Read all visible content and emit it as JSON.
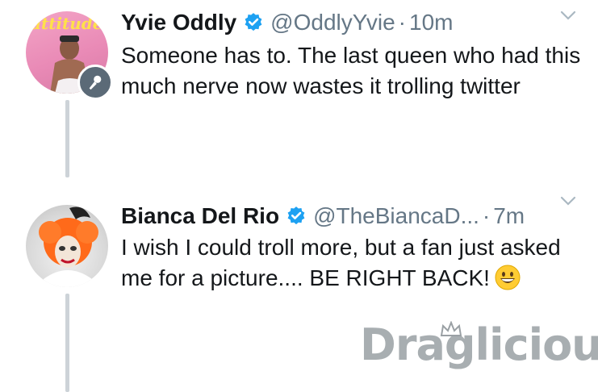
{
  "tweets": [
    {
      "name": "Yvie Oddly",
      "handle": "@OddlyYvie",
      "separator": "·",
      "time": "10m",
      "text": "Someone has to. The last queen who had this much nerve now wastes it trolling twitter",
      "avatar_icon": "profile-photo",
      "badge_icon": "microphone-icon"
    },
    {
      "name": "Bianca Del Rio",
      "handle": "@TheBiancaD...",
      "separator": "·",
      "time": "7m",
      "text": "I wish I could troll more, but  a fan just asked me for a picture.... BE RIGHT BACK!",
      "emoji": "grinning-face-emoji",
      "avatar_icon": "profile-photo"
    }
  ],
  "watermark": {
    "text": "Draglicious",
    "logo": "crown-icon"
  },
  "colors": {
    "verified": "#1da1f2",
    "muted": "#657786",
    "text": "#14171a",
    "thread_line": "#cdd3d8",
    "watermark": "#9aa0a4"
  }
}
